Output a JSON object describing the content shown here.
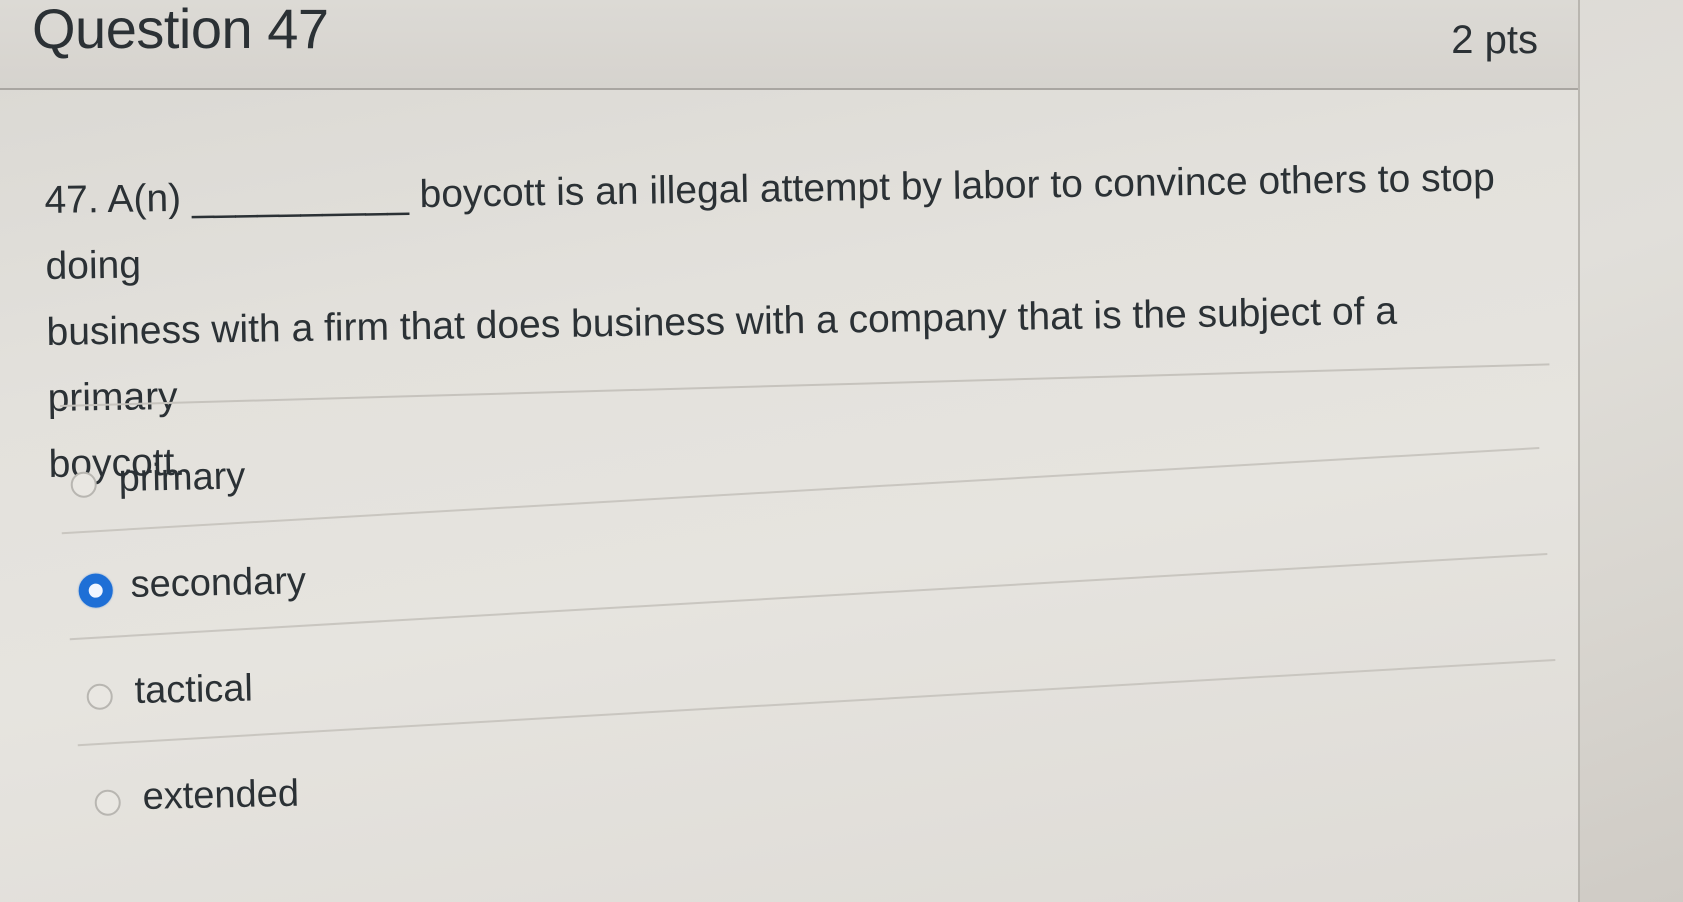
{
  "header": {
    "title": "Question 47",
    "points": "2 pts"
  },
  "question": {
    "line1": "47. A(n) __________ boycott is an illegal attempt by labor to convince others to stop doing",
    "line2": "business with a firm that does business with a company that is the subject of a primary",
    "line3": "boycott."
  },
  "answers": [
    {
      "label": "primary",
      "selected": false
    },
    {
      "label": "secondary",
      "selected": true
    },
    {
      "label": "tactical",
      "selected": false
    },
    {
      "label": "extended",
      "selected": false
    }
  ],
  "colors": {
    "accent": "#1e6fd6",
    "text": "#2b3135"
  }
}
